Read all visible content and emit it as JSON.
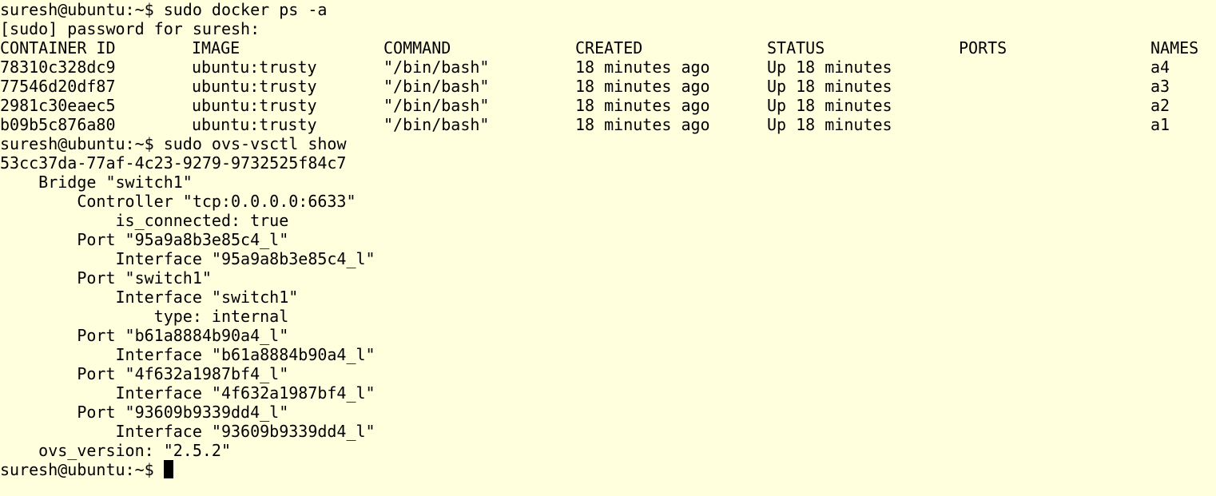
{
  "terminal": {
    "prompt": "suresh@ubuntu:~$",
    "cmd1": "sudo docker ps -a",
    "sudo_prompt": "[sudo] password for suresh:",
    "docker_headers": [
      "CONTAINER ID",
      "IMAGE",
      "COMMAND",
      "CREATED",
      "STATUS",
      "PORTS",
      "NAMES"
    ],
    "docker_rows": [
      [
        "78310c328dc9",
        "ubuntu:trusty",
        "\"/bin/bash\"",
        "18 minutes ago",
        "Up 18 minutes",
        "",
        "a4"
      ],
      [
        "77546d20df87",
        "ubuntu:trusty",
        "\"/bin/bash\"",
        "18 minutes ago",
        "Up 18 minutes",
        "",
        "a3"
      ],
      [
        "2981c30eaec5",
        "ubuntu:trusty",
        "\"/bin/bash\"",
        "18 minutes ago",
        "Up 18 minutes",
        "",
        "a2"
      ],
      [
        "b09b5c876a80",
        "ubuntu:trusty",
        "\"/bin/bash\"",
        "18 minutes ago",
        "Up 18 minutes",
        "",
        "a1"
      ]
    ],
    "cmd2": "sudo ovs-vsctl show",
    "ovs_lines": [
      "53cc37da-77af-4c23-9279-9732525f84c7",
      "    Bridge \"switch1\"",
      "        Controller \"tcp:0.0.0.0:6633\"",
      "            is_connected: true",
      "        Port \"95a9a8b3e85c4_l\"",
      "            Interface \"95a9a8b3e85c4_l\"",
      "        Port \"switch1\"",
      "            Interface \"switch1\"",
      "                type: internal",
      "        Port \"b61a8884b90a4_l\"",
      "            Interface \"b61a8884b90a4_l\"",
      "        Port \"4f632a1987bf4_l\"",
      "            Interface \"4f632a1987bf4_l\"",
      "        Port \"93609b9339dd4_l\"",
      "            Interface \"93609b9339dd4_l\"",
      "    ovs_version: \"2.5.2\""
    ],
    "colors": {
      "background": "#ffffdd",
      "foreground": "#000000"
    }
  }
}
